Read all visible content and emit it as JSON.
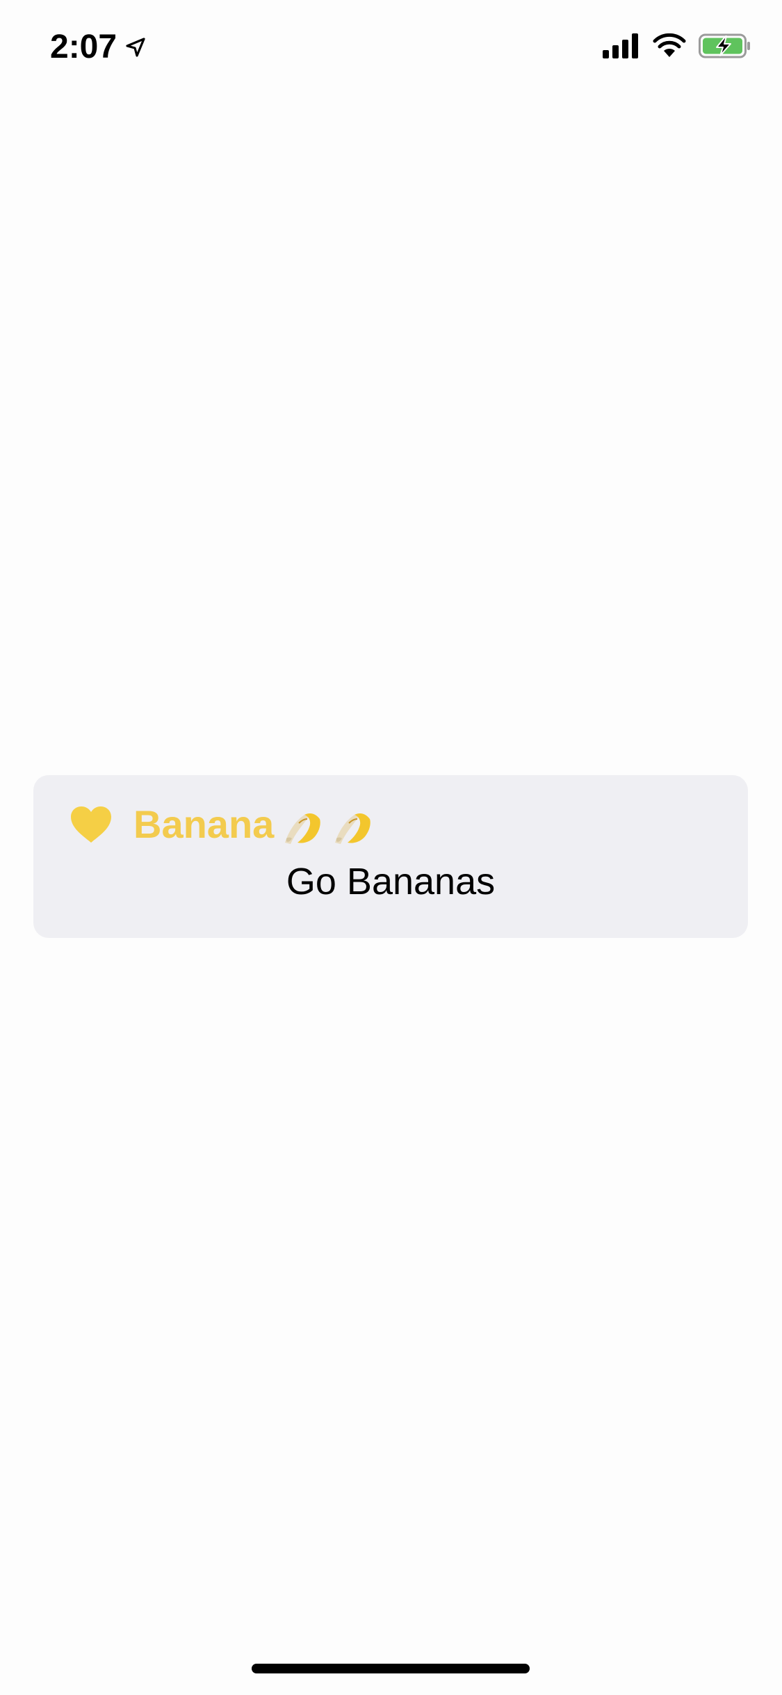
{
  "status_bar": {
    "time": "2:07",
    "icons": [
      "location-arrow-icon",
      "cellular-signal-icon",
      "wifi-icon",
      "battery-charging-icon"
    ],
    "battery_color": "#5fc35d"
  },
  "banner": {
    "title": "Banana",
    "message": "Go Bananas",
    "title_color": "#f3cb4e",
    "background_color": "#efeff3",
    "icons": [
      "yellow-heart-icon",
      "banana-icon",
      "banana-icon"
    ]
  }
}
